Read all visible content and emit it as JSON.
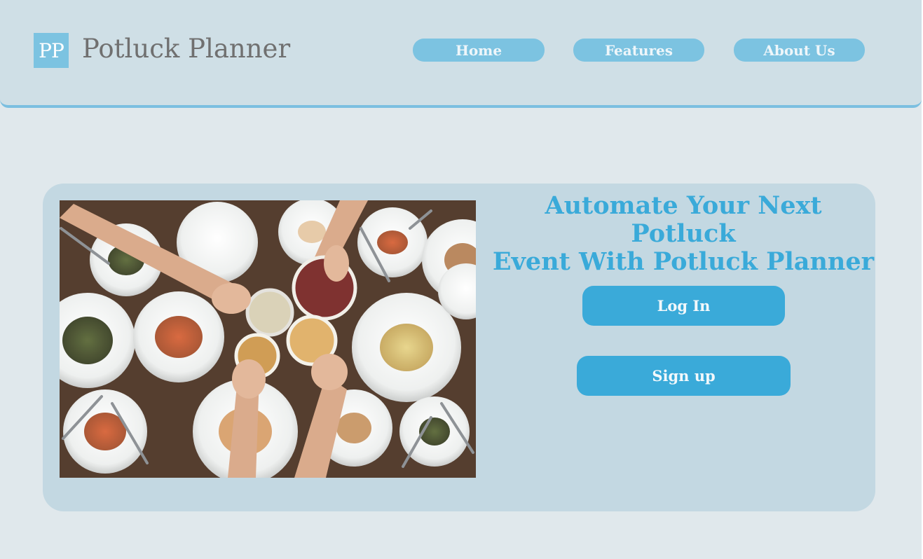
{
  "header": {
    "logo_initials": "PP",
    "brand_name": "Potluck Planner",
    "nav": [
      {
        "label": "Home"
      },
      {
        "label": "Features"
      },
      {
        "label": "About Us"
      }
    ]
  },
  "hero": {
    "headline_line1": "Automate Your Next Potluck",
    "headline_line2": "Event With Potluck Planner",
    "login_label": "Log In",
    "signup_label": "Sign up",
    "image_icon": "dinner-table-toast-photo"
  },
  "colors": {
    "page_bg": "#e0e8ec",
    "header_bg": "#cfdfe6",
    "accent_light": "#7cc3e1",
    "accent": "#3aaad9",
    "hero_panel": "#c3d8e2",
    "brand_text": "#707070"
  }
}
